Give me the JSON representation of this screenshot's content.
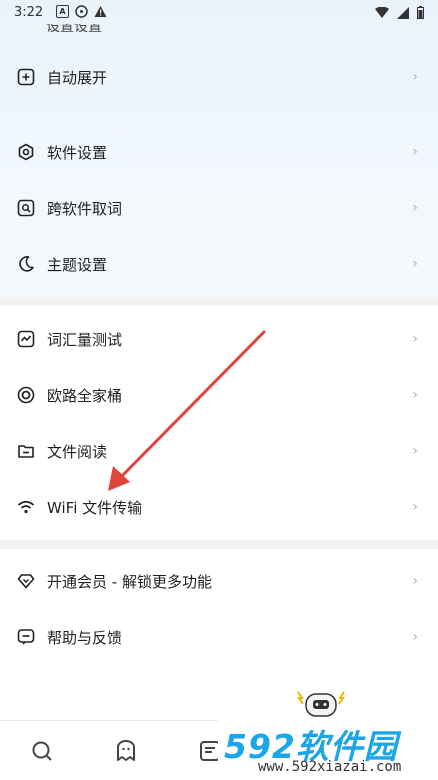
{
  "status_bar": {
    "time": "3:22",
    "icons": [
      "a-icon",
      "accessibility-icon",
      "warning-icon"
    ]
  },
  "partial_row_label": "设置设置",
  "sections": [
    [
      {
        "label": "自动展开",
        "icon": "plus-square-icon"
      }
    ],
    [
      {
        "label": "软件设置",
        "icon": "hexagon-settings-icon"
      },
      {
        "label": "跨软件取词",
        "icon": "search-square-icon"
      },
      {
        "label": "主题设置",
        "icon": "moon-icon"
      }
    ],
    [
      {
        "label": "词汇量测试",
        "icon": "chart-square-icon"
      },
      {
        "label": "欧路全家桶",
        "icon": "eudic-circle-icon"
      },
      {
        "label": "文件阅读",
        "icon": "folder-icon"
      },
      {
        "label": "WiFi 文件传输",
        "icon": "wifi-icon"
      }
    ],
    [
      {
        "label": "开通会员 - 解锁更多功能",
        "icon": "diamond-icon"
      },
      {
        "label": "帮助与反馈",
        "icon": "message-square-icon"
      }
    ]
  ],
  "chevron": "›",
  "bottom_tabs": [
    {
      "icon": "search-icon"
    },
    {
      "icon": "ghost-icon"
    },
    {
      "icon": "notes-icon"
    }
  ],
  "watermark": {
    "logo_text": "592软件园",
    "url": "www.592xiazai.com"
  },
  "annotation": {
    "type": "red-arrow",
    "points_to": "WiFi 文件传输",
    "color": "#e0453c"
  }
}
